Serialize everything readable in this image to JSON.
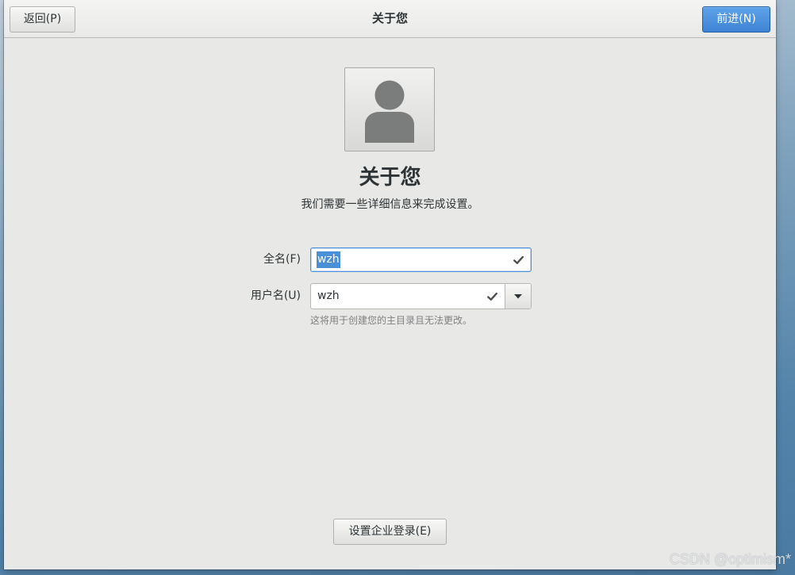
{
  "colors": {
    "accent": "#4a90d9",
    "suggested_action": "#3d84d4",
    "background": "#e8e8e7",
    "text": "#2e3436",
    "dim_text": "#7f8281"
  },
  "headerbar": {
    "back_label": "返回(P)",
    "title": "关于您",
    "next_label": "前进(N)"
  },
  "avatar": {
    "icon": "user-avatar-icon"
  },
  "page": {
    "heading": "关于您",
    "description": "我们需要一些详细信息来完成设置。"
  },
  "form": {
    "full_name": {
      "label": "全名(F)",
      "value": "wzh",
      "focused": true,
      "text_selected": true,
      "status_icon": "check-icon"
    },
    "username": {
      "label": "用户名(U)",
      "value": "wzh",
      "status_icon": "check-icon",
      "dropdown_icon": "chevron-down-icon",
      "hint": "这将用于创建您的主目录且无法更改。"
    }
  },
  "enterprise_login": {
    "label": "设置企业登录(E)"
  },
  "watermark": "CSDN @optimism*"
}
